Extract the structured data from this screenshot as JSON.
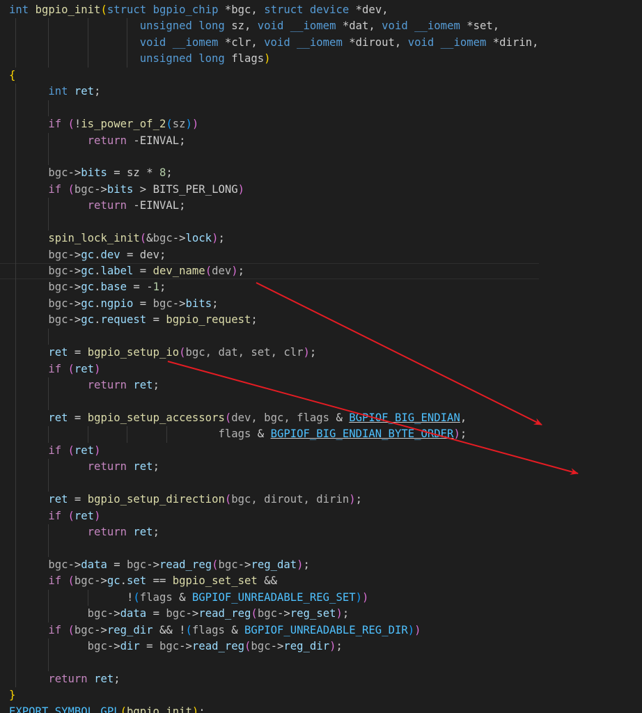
{
  "colors": {
    "background": "#1e1e1e",
    "annotation_arrow": "#e51c23"
  },
  "annotations": [
    {
      "name": "arrow-to-dev-name",
      "icon": "red-arrow-icon"
    },
    {
      "name": "arrow-to-bgpio-setup-io",
      "icon": "red-arrow-icon"
    }
  ],
  "lines": [
    [
      [
        "k",
        "int"
      ],
      [
        "",
        "␣"
      ],
      [
        "f",
        "bgpio_init"
      ],
      [
        "p1",
        "("
      ],
      [
        "k",
        "struct"
      ],
      [
        "",
        "␣"
      ],
      [
        "k",
        "bgpio_chip"
      ],
      [
        "",
        "␣*bgc,␣"
      ],
      [
        "k",
        "struct"
      ],
      [
        "",
        "␣"
      ],
      [
        "k",
        "device"
      ],
      [
        "",
        "␣*dev,"
      ]
    ],
    [
      [
        "",
        "␣␣␣␣␣␣␣␣␣␣␣␣␣␣␣␣␣␣␣␣"
      ],
      [
        "k",
        "unsigned"
      ],
      [
        "",
        "␣"
      ],
      [
        "k",
        "long"
      ],
      [
        "",
        "␣sz,␣"
      ],
      [
        "k",
        "void"
      ],
      [
        "",
        "␣"
      ],
      [
        "k",
        "__iomem"
      ],
      [
        "",
        "␣*dat,␣"
      ],
      [
        "k",
        "void"
      ],
      [
        "",
        "␣"
      ],
      [
        "k",
        "__iomem"
      ],
      [
        "",
        "␣*set,"
      ]
    ],
    [
      [
        "",
        "␣␣␣␣␣␣␣␣␣␣␣␣␣␣␣␣␣␣␣␣"
      ],
      [
        "k",
        "void"
      ],
      [
        "",
        "␣"
      ],
      [
        "k",
        "__iomem"
      ],
      [
        "",
        "␣*clr,␣"
      ],
      [
        "k",
        "void"
      ],
      [
        "",
        "␣"
      ],
      [
        "k",
        "__iomem"
      ],
      [
        "",
        "␣*dirout,␣"
      ],
      [
        "k",
        "void"
      ],
      [
        "",
        "␣"
      ],
      [
        "k",
        "__iomem"
      ],
      [
        "",
        "␣*dirin,"
      ]
    ],
    [
      [
        "",
        "␣␣␣␣␣␣␣␣␣␣␣␣␣␣␣␣␣␣␣␣"
      ],
      [
        "k",
        "unsigned"
      ],
      [
        "",
        "␣"
      ],
      [
        "k",
        "long"
      ],
      [
        "",
        "␣flags"
      ],
      [
        "p1",
        ")"
      ]
    ],
    [
      [
        "p1",
        "{"
      ]
    ],
    [
      [
        "",
        "␣␣␣␣␣␣"
      ],
      [
        "k",
        "int"
      ],
      [
        "",
        "␣"
      ],
      [
        "v",
        "ret"
      ],
      [
        "",
        ";"
      ]
    ],
    [],
    [
      [
        "",
        "␣␣␣␣␣␣"
      ],
      [
        "c",
        "if"
      ],
      [
        "",
        "␣"
      ],
      [
        "p2",
        "("
      ],
      [
        "",
        "!"
      ],
      [
        "f",
        "is_power_of_2"
      ],
      [
        "p3",
        "("
      ],
      [
        "d",
        "sz"
      ],
      [
        "p3",
        ")"
      ],
      [
        "p2",
        ")"
      ]
    ],
    [
      [
        "",
        "␣␣␣␣␣␣␣␣␣␣␣␣"
      ],
      [
        "c",
        "return"
      ],
      [
        "",
        "␣-EINVAL;"
      ]
    ],
    [],
    [
      [
        "",
        "␣␣␣␣␣␣"
      ],
      [
        "d",
        "bgc"
      ],
      [
        "",
        "->"
      ],
      [
        "v",
        "bits"
      ],
      [
        "",
        "␣=␣sz␣*␣"
      ],
      [
        "n",
        "8"
      ],
      [
        "",
        ";"
      ]
    ],
    [
      [
        "",
        "␣␣␣␣␣␣"
      ],
      [
        "c",
        "if"
      ],
      [
        "",
        "␣"
      ],
      [
        "p2",
        "("
      ],
      [
        "d",
        "bgc"
      ],
      [
        "",
        "->"
      ],
      [
        "v",
        "bits"
      ],
      [
        "",
        "␣>␣BITS_PER_LONG"
      ],
      [
        "p2",
        ")"
      ]
    ],
    [
      [
        "",
        "␣␣␣␣␣␣␣␣␣␣␣␣"
      ],
      [
        "c",
        "return"
      ],
      [
        "",
        "␣-EINVAL;"
      ]
    ],
    [],
    [
      [
        "",
        "␣␣␣␣␣␣"
      ],
      [
        "f",
        "spin_lock_init"
      ],
      [
        "p2",
        "("
      ],
      [
        "",
        "&"
      ],
      [
        "d",
        "bgc"
      ],
      [
        "",
        "->"
      ],
      [
        "v",
        "lock"
      ],
      [
        "p2",
        ")"
      ],
      [
        "",
        ";"
      ]
    ],
    [
      [
        "",
        "␣␣␣␣␣␣"
      ],
      [
        "d",
        "bgc"
      ],
      [
        "",
        "->"
      ],
      [
        "v",
        "gc"
      ],
      [
        "",
        "."
      ],
      [
        "v",
        "dev"
      ],
      [
        "",
        "␣=␣dev;"
      ]
    ],
    [
      [
        "",
        "␣␣␣␣␣␣"
      ],
      [
        "d",
        "bgc"
      ],
      [
        "",
        "->"
      ],
      [
        "v",
        "gc"
      ],
      [
        "",
        "."
      ],
      [
        "v",
        "label"
      ],
      [
        "",
        "␣=␣"
      ],
      [
        "f",
        "dev_name"
      ],
      [
        "p2",
        "("
      ],
      [
        "d",
        "dev"
      ],
      [
        "p2",
        ")"
      ],
      [
        "",
        ";"
      ]
    ],
    [
      [
        "",
        "␣␣␣␣␣␣"
      ],
      [
        "d",
        "bgc"
      ],
      [
        "",
        "->"
      ],
      [
        "v",
        "gc"
      ],
      [
        "",
        "."
      ],
      [
        "v",
        "base"
      ],
      [
        "",
        "␣=␣-"
      ],
      [
        "n",
        "1"
      ],
      [
        "",
        ";"
      ]
    ],
    [
      [
        "",
        "␣␣␣␣␣␣"
      ],
      [
        "d",
        "bgc"
      ],
      [
        "",
        "->"
      ],
      [
        "v",
        "gc"
      ],
      [
        "",
        "."
      ],
      [
        "v",
        "ngpio"
      ],
      [
        "",
        "␣=␣"
      ],
      [
        "d",
        "bgc"
      ],
      [
        "",
        "->"
      ],
      [
        "v",
        "bits"
      ],
      [
        "",
        ";"
      ]
    ],
    [
      [
        "",
        "␣␣␣␣␣␣"
      ],
      [
        "d",
        "bgc"
      ],
      [
        "",
        "->"
      ],
      [
        "v",
        "gc"
      ],
      [
        "",
        "."
      ],
      [
        "v",
        "request"
      ],
      [
        "",
        "␣=␣"
      ],
      [
        "f",
        "bgpio_request"
      ],
      [
        "",
        ";"
      ]
    ],
    [],
    [
      [
        "",
        "␣␣␣␣␣␣"
      ],
      [
        "v",
        "ret"
      ],
      [
        "",
        "␣=␣"
      ],
      [
        "f",
        "bgpio_setup_io"
      ],
      [
        "p2",
        "("
      ],
      [
        "d",
        "bgc,␣dat,␣set,␣clr"
      ],
      [
        "p2",
        ")"
      ],
      [
        "",
        ";"
      ]
    ],
    [
      [
        "",
        "␣␣␣␣␣␣"
      ],
      [
        "c",
        "if"
      ],
      [
        "",
        "␣"
      ],
      [
        "p2",
        "("
      ],
      [
        "v",
        "ret"
      ],
      [
        "p2",
        ")"
      ]
    ],
    [
      [
        "",
        "␣␣␣␣␣␣␣␣␣␣␣␣"
      ],
      [
        "c",
        "return"
      ],
      [
        "",
        "␣"
      ],
      [
        "v",
        "ret"
      ],
      [
        "",
        ";"
      ]
    ],
    [],
    [
      [
        "",
        "␣␣␣␣␣␣"
      ],
      [
        "v",
        "ret"
      ],
      [
        "",
        "␣=␣"
      ],
      [
        "f",
        "bgpio_setup_accessors"
      ],
      [
        "p2",
        "("
      ],
      [
        "d",
        "dev,␣bgc,␣flags"
      ],
      [
        "",
        "␣&␣"
      ],
      [
        "m u",
        "BGPIOF_BIG_ENDIAN"
      ],
      [
        "",
        ","
      ]
    ],
    [
      [
        "",
        "␣␣␣␣␣␣␣␣␣␣␣␣␣␣␣␣␣␣␣␣␣␣␣␣␣␣␣␣␣␣␣␣"
      ],
      [
        "d",
        "flags"
      ],
      [
        "",
        "␣&␣"
      ],
      [
        "m u",
        "BGPIOF_BIG_ENDIAN_BYTE_ORDER"
      ],
      [
        "p2",
        ")"
      ],
      [
        "",
        ";"
      ]
    ],
    [
      [
        "",
        "␣␣␣␣␣␣"
      ],
      [
        "c",
        "if"
      ],
      [
        "",
        "␣"
      ],
      [
        "p2",
        "("
      ],
      [
        "v",
        "ret"
      ],
      [
        "p2",
        ")"
      ]
    ],
    [
      [
        "",
        "␣␣␣␣␣␣␣␣␣␣␣␣"
      ],
      [
        "c",
        "return"
      ],
      [
        "",
        "␣"
      ],
      [
        "v",
        "ret"
      ],
      [
        "",
        ";"
      ]
    ],
    [],
    [
      [
        "",
        "␣␣␣␣␣␣"
      ],
      [
        "v",
        "ret"
      ],
      [
        "",
        "␣=␣"
      ],
      [
        "f",
        "bgpio_setup_direction"
      ],
      [
        "p2",
        "("
      ],
      [
        "d",
        "bgc,␣dirout,␣dirin"
      ],
      [
        "p2",
        ")"
      ],
      [
        "",
        ";"
      ]
    ],
    [
      [
        "",
        "␣␣␣␣␣␣"
      ],
      [
        "c",
        "if"
      ],
      [
        "",
        "␣"
      ],
      [
        "p2",
        "("
      ],
      [
        "v",
        "ret"
      ],
      [
        "p2",
        ")"
      ]
    ],
    [
      [
        "",
        "␣␣␣␣␣␣␣␣␣␣␣␣"
      ],
      [
        "c",
        "return"
      ],
      [
        "",
        "␣"
      ],
      [
        "v",
        "ret"
      ],
      [
        "",
        ";"
      ]
    ],
    [],
    [
      [
        "",
        "␣␣␣␣␣␣"
      ],
      [
        "d",
        "bgc"
      ],
      [
        "",
        "->"
      ],
      [
        "v",
        "data"
      ],
      [
        "",
        "␣=␣"
      ],
      [
        "d",
        "bgc"
      ],
      [
        "",
        "->"
      ],
      [
        "v",
        "read_reg"
      ],
      [
        "p2",
        "("
      ],
      [
        "d",
        "bgc"
      ],
      [
        "",
        "->"
      ],
      [
        "v",
        "reg_dat"
      ],
      [
        "p2",
        ")"
      ],
      [
        "",
        ";"
      ]
    ],
    [
      [
        "",
        "␣␣␣␣␣␣"
      ],
      [
        "c",
        "if"
      ],
      [
        "",
        "␣"
      ],
      [
        "p2",
        "("
      ],
      [
        "d",
        "bgc"
      ],
      [
        "",
        "->"
      ],
      [
        "v",
        "gc"
      ],
      [
        "",
        "."
      ],
      [
        "v",
        "set"
      ],
      [
        "",
        "␣==␣"
      ],
      [
        "f",
        "bgpio_set_set"
      ],
      [
        "",
        "␣&&"
      ]
    ],
    [
      [
        "",
        "␣␣␣␣␣␣␣␣␣␣␣␣␣␣␣␣␣␣"
      ],
      [
        "",
        "!"
      ],
      [
        "p3",
        "("
      ],
      [
        "d",
        "flags"
      ],
      [
        "",
        "␣&␣"
      ],
      [
        "m",
        "BGPIOF_UNREADABLE_REG_SET"
      ],
      [
        "p3",
        ")"
      ],
      [
        "p2",
        ")"
      ]
    ],
    [
      [
        "",
        "␣␣␣␣␣␣␣␣␣␣␣␣"
      ],
      [
        "d",
        "bgc"
      ],
      [
        "",
        "->"
      ],
      [
        "v",
        "data"
      ],
      [
        "",
        "␣=␣"
      ],
      [
        "d",
        "bgc"
      ],
      [
        "",
        "->"
      ],
      [
        "v",
        "read_reg"
      ],
      [
        "p2",
        "("
      ],
      [
        "d",
        "bgc"
      ],
      [
        "",
        "->"
      ],
      [
        "v",
        "reg_set"
      ],
      [
        "p2",
        ")"
      ],
      [
        "",
        ";"
      ]
    ],
    [
      [
        "",
        "␣␣␣␣␣␣"
      ],
      [
        "c",
        "if"
      ],
      [
        "",
        "␣"
      ],
      [
        "p2",
        "("
      ],
      [
        "d",
        "bgc"
      ],
      [
        "",
        "->"
      ],
      [
        "v",
        "reg_dir"
      ],
      [
        "",
        "␣&&␣!"
      ],
      [
        "p3",
        "("
      ],
      [
        "d",
        "flags"
      ],
      [
        "",
        "␣&␣"
      ],
      [
        "m",
        "BGPIOF_UNREADABLE_REG_DIR"
      ],
      [
        "p3",
        ")"
      ],
      [
        "p2",
        ")"
      ]
    ],
    [
      [
        "",
        "␣␣␣␣␣␣␣␣␣␣␣␣"
      ],
      [
        "d",
        "bgc"
      ],
      [
        "",
        "->"
      ],
      [
        "v",
        "dir"
      ],
      [
        "",
        "␣=␣"
      ],
      [
        "d",
        "bgc"
      ],
      [
        "",
        "->"
      ],
      [
        "v",
        "read_reg"
      ],
      [
        "p2",
        "("
      ],
      [
        "d",
        "bgc"
      ],
      [
        "",
        "->"
      ],
      [
        "v",
        "reg_dir"
      ],
      [
        "p2",
        ")"
      ],
      [
        "",
        ";"
      ]
    ],
    [],
    [
      [
        "",
        "␣␣␣␣␣␣"
      ],
      [
        "c",
        "return"
      ],
      [
        "",
        "␣"
      ],
      [
        "v",
        "ret"
      ],
      [
        "",
        ";"
      ]
    ],
    [
      [
        "p1",
        "}"
      ]
    ],
    [
      [
        "m",
        "EXPORT_SYMBOL_GPL"
      ],
      [
        "p1",
        "("
      ],
      [
        "f",
        "bgpio_init"
      ],
      [
        "p1",
        ")"
      ],
      [
        "",
        ";"
      ]
    ]
  ]
}
